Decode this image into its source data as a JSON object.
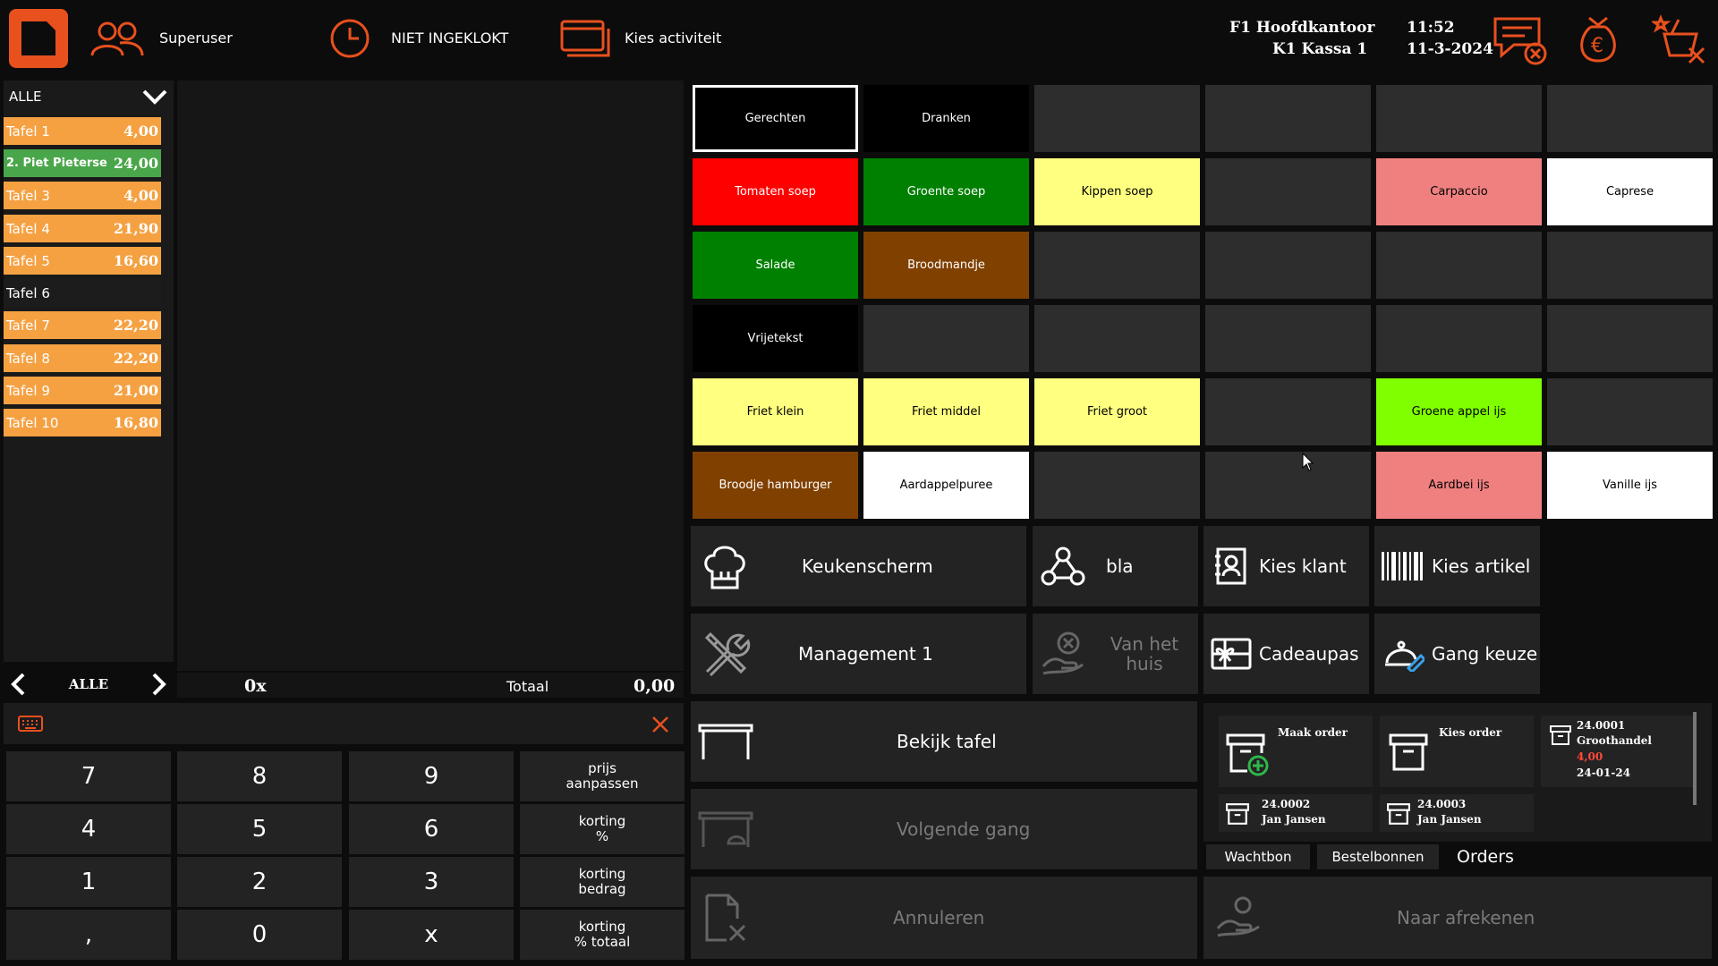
{
  "header": {
    "user": "Superuser",
    "clock_status": "NIET INGEKLOKT",
    "activity": "Kies activiteit",
    "location_line1": "F1 Hoofdkantoor",
    "location_line2": "K1 Kassa 1",
    "time": "11:52",
    "date": "11-3-2024"
  },
  "tables": {
    "filter": "ALLE",
    "items": [
      {
        "name": "Tafel 1",
        "amount": "4,00"
      },
      {
        "name": "2. Piet Pieterse",
        "amount": "24,00"
      },
      {
        "name": "Tafel 3",
        "amount": "4,00"
      },
      {
        "name": "Tafel 4",
        "amount": "21,90"
      },
      {
        "name": "Tafel 5",
        "amount": "16,60"
      },
      {
        "name": "Tafel 6",
        "amount": ""
      },
      {
        "name": "Tafel 7",
        "amount": "22,20"
      },
      {
        "name": "Tafel 8",
        "amount": "22,20"
      },
      {
        "name": "Tafel 9",
        "amount": "21,00"
      },
      {
        "name": "Tafel 10",
        "amount": "16,80"
      }
    ],
    "pager_label": "ALLE"
  },
  "order": {
    "count": "0x",
    "total_label": "Totaal",
    "total": "0,00"
  },
  "products": {
    "gerechten": "Gerechten",
    "dranken": "Dranken",
    "tomaten_soep": "Tomaten soep",
    "groente_soep": "Groente soep",
    "kippen_soep": "Kippen soep",
    "carpaccio": "Carpaccio",
    "caprese": "Caprese",
    "salade": "Salade",
    "broodmandje": "Broodmandje",
    "vrijetekst": "Vrijetekst",
    "friet_klein": "Friet klein",
    "friet_middel": "Friet middel",
    "friet_groot": "Friet groot",
    "groene_appel_ijs": "Groene appel ijs",
    "broodje_hamburger": "Broodje hamburger",
    "aardappelpuree": "Aardappelpuree",
    "aardbei_ijs": "Aardbei ijs",
    "vanille_ijs": "Vanille ijs"
  },
  "functions": {
    "keukenscherm": "Keukenscherm",
    "bla": "bla",
    "kies_klant": "Kies klant",
    "kies_artikel": "Kies artikel",
    "management": "Management 1",
    "van_het_huis": "Van het huis",
    "cadeaupas": "Cadeaupas",
    "gang_keuze": "Gang keuze",
    "bekijk_tafel": "Bekijk tafel",
    "volgende_gang": "Volgende gang",
    "annuleren": "Annuleren",
    "naar_afrekenen": "Naar afrekenen"
  },
  "keypad": {
    "k7": "7",
    "k8": "8",
    "k9": "9",
    "prijs": "prijs\naanpassen",
    "k4": "4",
    "k5": "5",
    "k6": "6",
    "korting_pct": "korting\n%",
    "k1": "1",
    "k2": "2",
    "k3": "3",
    "korting_bedrag": "korting\nbedrag",
    "comma": ",",
    "k0": "0",
    "x": "x",
    "korting_totaal": "korting\n% totaal"
  },
  "orders_panel": {
    "maak_order": "Maak order",
    "kies_order": "Kies order",
    "order1": {
      "number": "24.0001",
      "customer": "Groothandel",
      "amount": "4,00",
      "date": "24-01-24"
    },
    "order2": {
      "number": "24.0002",
      "customer": "Jan Jansen"
    },
    "order3": {
      "number": "24.0003",
      "customer": "Jan Jansen"
    },
    "tabs": [
      "Wachtbon",
      "Bestelbonnen",
      "Orders"
    ]
  },
  "colors": {
    "accent": "#e8501e",
    "orange": "#f5a142",
    "green_row": "#4aa64a",
    "red": "#ff0000",
    "green": "#008000",
    "yellow": "#ffff80",
    "salmon": "#f08080",
    "brown": "#804000",
    "lime": "#80ff00"
  }
}
